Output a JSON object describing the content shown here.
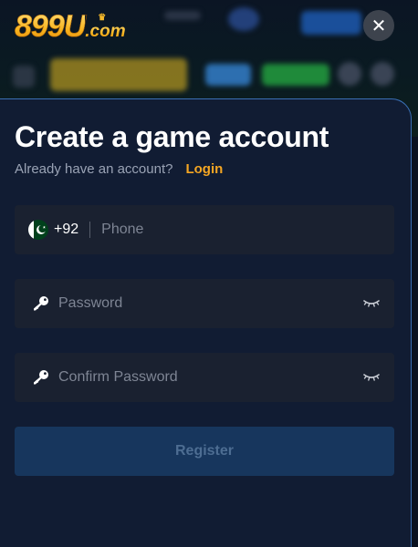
{
  "logo": {
    "main": "899U",
    "suffix": ".com"
  },
  "header": {
    "close_label": "✕"
  },
  "form": {
    "title": "Create a game account",
    "subtitle": "Already have an account?",
    "login_label": "Login",
    "phone": {
      "country_code": "+92",
      "placeholder": "Phone"
    },
    "password": {
      "placeholder": "Password"
    },
    "confirm_password": {
      "placeholder": "Confirm Password"
    },
    "register_label": "Register"
  },
  "colors": {
    "accent": "#f5a623",
    "sheet_bg": "#111c33",
    "field_bg": "#1a2130",
    "register_bg": "#17365d"
  }
}
